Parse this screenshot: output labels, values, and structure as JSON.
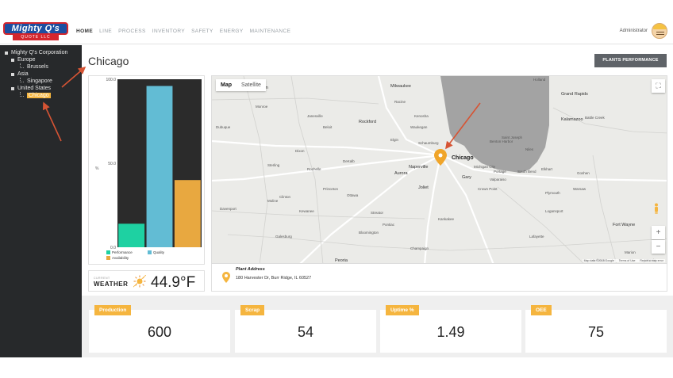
{
  "brand": {
    "logo_text": "Mighty Q's",
    "logo_subtext": "QUOTE LLC"
  },
  "nav": {
    "items": [
      {
        "label": "HOME",
        "active": true
      },
      {
        "label": "LINE",
        "active": false
      },
      {
        "label": "PROCESS",
        "active": false
      },
      {
        "label": "INVENTORY",
        "active": false
      },
      {
        "label": "SAFETY",
        "active": false
      },
      {
        "label": "ENERGY",
        "active": false
      },
      {
        "label": "MAINTENANCE",
        "active": false
      }
    ],
    "user_label": "Administrator"
  },
  "sidebar": {
    "root": "Mighty Q's Corporation",
    "regions": [
      {
        "label": "Europe",
        "sites": [
          "Brussels"
        ]
      },
      {
        "label": "Asia",
        "sites": [
          "Singapore"
        ]
      },
      {
        "label": "United States",
        "sites": [
          "Chicago"
        ]
      }
    ],
    "selected_site": "Chicago"
  },
  "main": {
    "title": "Chicago",
    "perf_button_label": "PLANTS PERFORMANCE CHART"
  },
  "chart_data": {
    "type": "bar",
    "categories": [
      "Performance",
      "Quality",
      "Availability"
    ],
    "values": [
      14,
      96,
      40
    ],
    "colors": [
      "#1ed1a2",
      "#62bcd4",
      "#e8a840"
    ],
    "ylim": [
      0,
      100
    ],
    "yticks": [
      "0.0",
      "50.0",
      "100.0"
    ],
    "ylabel": "%",
    "plot_bg": "#2b2b2b"
  },
  "weather": {
    "label_small": "CURRENT",
    "label": "WEATHER",
    "temperature": "44.9°F"
  },
  "map": {
    "tabs": [
      "Map",
      "Satellite"
    ],
    "active_tab": "Map",
    "cities": [
      "Madison",
      "Milwaukee",
      "Holland",
      "Racine",
      "Kenosha",
      "Grand Rapids",
      "Rockford",
      "Waukegan",
      "Kalamazoo",
      "Elgin",
      "Schaumburg",
      "Chicago",
      "Naperville",
      "Aurora",
      "Joliet",
      "Gary",
      "Portage",
      "South Bend",
      "Elkhart",
      "Battle Creek",
      "Dixon",
      "Ottawa",
      "Kankakee",
      "Fort Wayne",
      "Peoria",
      "Bloomington",
      "Champaign",
      "Galesburg",
      "Clinton",
      "Davenport",
      "Moline",
      "Dubuque",
      "DeKalb",
      "Sterling",
      "Rochelle",
      "Streator",
      "Pontiac",
      "Warsaw",
      "Logansport",
      "Lafayette",
      "Michigan City",
      "Valparaiso",
      "Crown Point",
      "Plymouth",
      "Goshen",
      "Niles",
      "Saint Joseph",
      "Benton Harbor",
      "Kewanee",
      "Princeton",
      "Monroe",
      "Janesville",
      "Beloit",
      "Kokomo",
      "Marion",
      "Muncie"
    ],
    "attribution": [
      "Map data ©2018 Google",
      "Terms of Use",
      "Report a map error"
    ],
    "address_title": "Plant Address",
    "address": "180 Harvester Dr, Burr Ridge, IL 60527",
    "water_color": "#a3a3a3",
    "marker_color": "#f0a52a"
  },
  "kpis": [
    {
      "label": "Production",
      "value": "600"
    },
    {
      "label": "Scrap",
      "value": "54"
    },
    {
      "label": "Uptime %",
      "value": "1.49"
    },
    {
      "label": "OEE",
      "value": "75"
    }
  ],
  "accent_color": "#f5b53f",
  "annotation_color": "#d65434"
}
